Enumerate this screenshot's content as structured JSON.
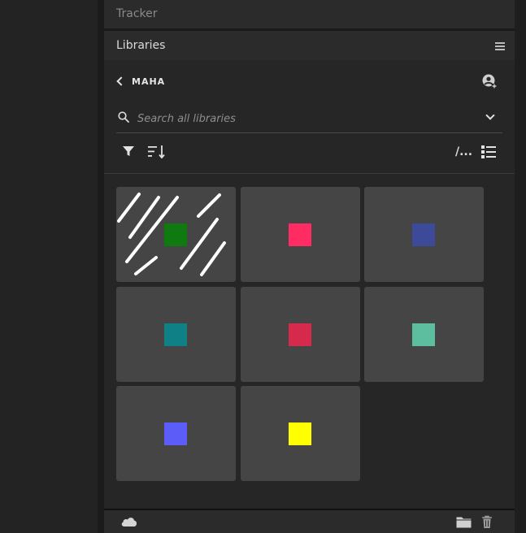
{
  "panels": {
    "tracker_title": "Tracker",
    "libraries_title": "Libraries"
  },
  "library": {
    "name": "MAHA",
    "back_label": "MAHA"
  },
  "search": {
    "placeholder": "Search all libraries",
    "value": ""
  },
  "toolbar": {
    "view_dots_label": "/..."
  },
  "colors": {
    "swatches": [
      "#0f7a0f",
      "#ff2c63",
      "#3d4a99",
      "#0e8086",
      "#d62a4c",
      "#5cbd9f",
      "#5c5cf8",
      "#ffff00"
    ]
  },
  "icons": {
    "header": [
      "menu-icon",
      "account-icon"
    ],
    "toolbar": [
      "filter-icon",
      "sort-icon",
      "list-view-icon"
    ],
    "footer": [
      "cloud-icon",
      "folder-icon",
      "trash-icon"
    ]
  }
}
